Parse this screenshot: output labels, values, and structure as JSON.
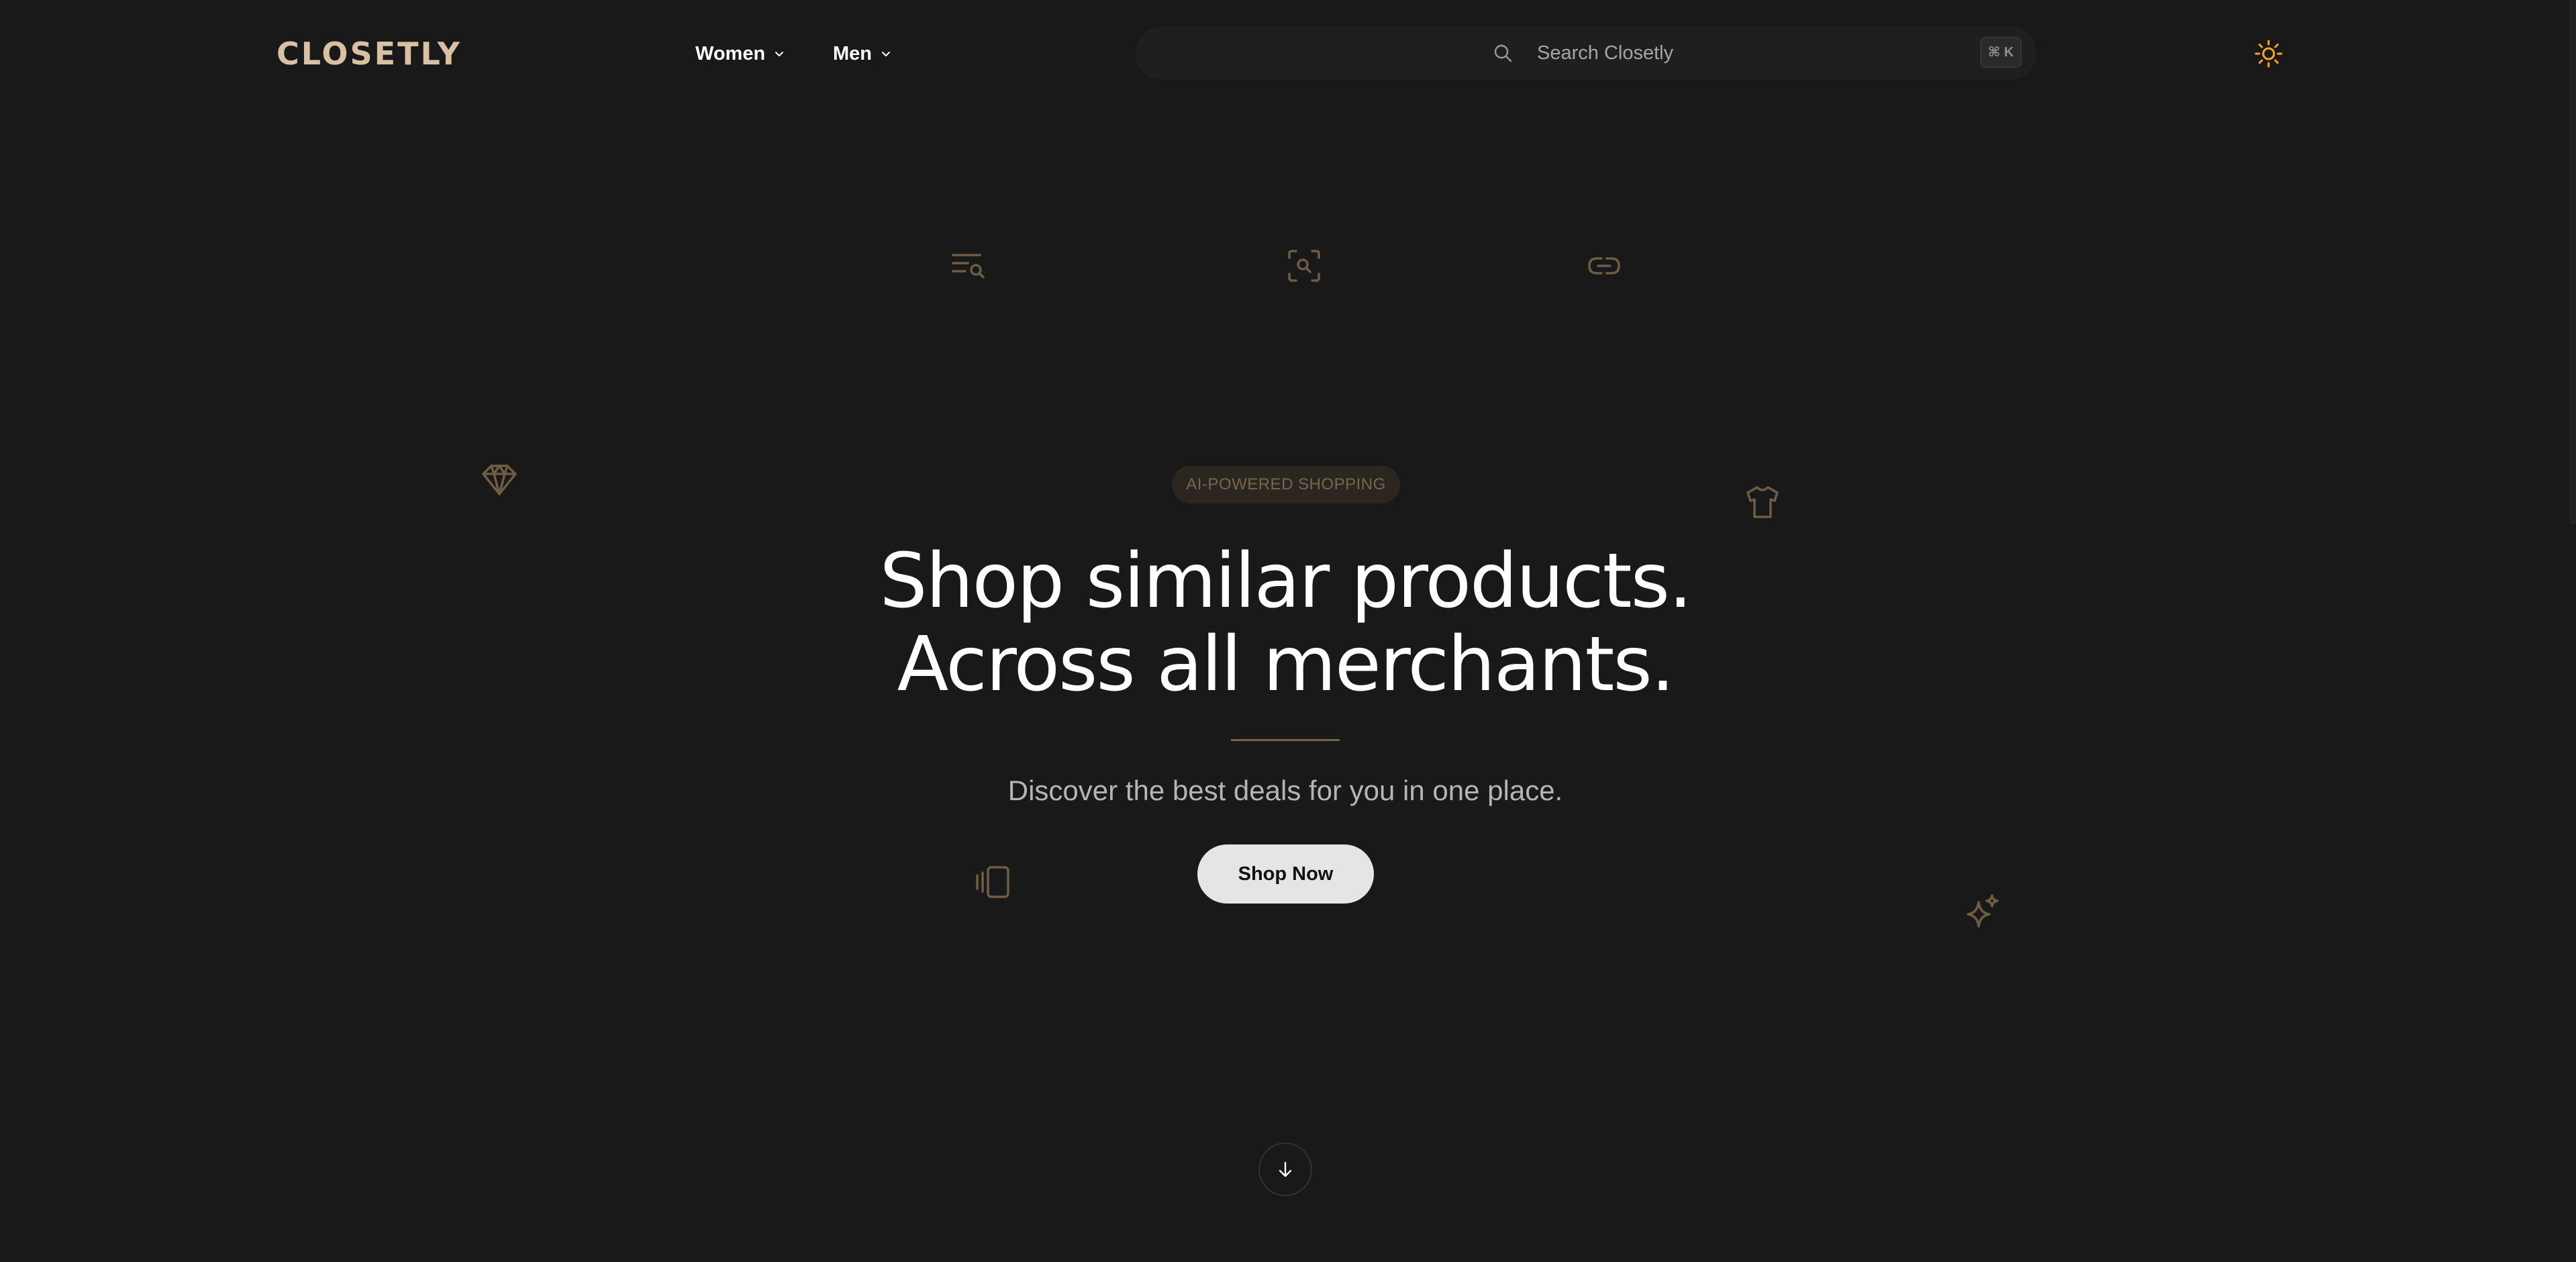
{
  "header": {
    "logo": "CLOSETLY",
    "nav": [
      {
        "label": "Women"
      },
      {
        "label": "Men"
      }
    ],
    "search": {
      "placeholder": "Search Closetly",
      "shortcut": "⌘ K"
    },
    "theme_icon": "sun-icon"
  },
  "decorative_icons": [
    "list-search-icon",
    "scan-search-icon",
    "link-icon",
    "diamond-icon",
    "tshirt-icon",
    "cards-swipe-icon",
    "sparkles-icon"
  ],
  "hero": {
    "badge": "AI-POWERED SHOPPING",
    "headline_line1": "Shop similar products.",
    "headline_line2": "Across all merchants.",
    "subtitle": "Discover the best deals for you in one place.",
    "cta": "Shop Now"
  },
  "scroll_icon": "arrow-down-icon",
  "colors": {
    "background": "#191919",
    "accent": "#d8c0a3",
    "deco": "#6e5d44",
    "sun": "#f4a724"
  }
}
